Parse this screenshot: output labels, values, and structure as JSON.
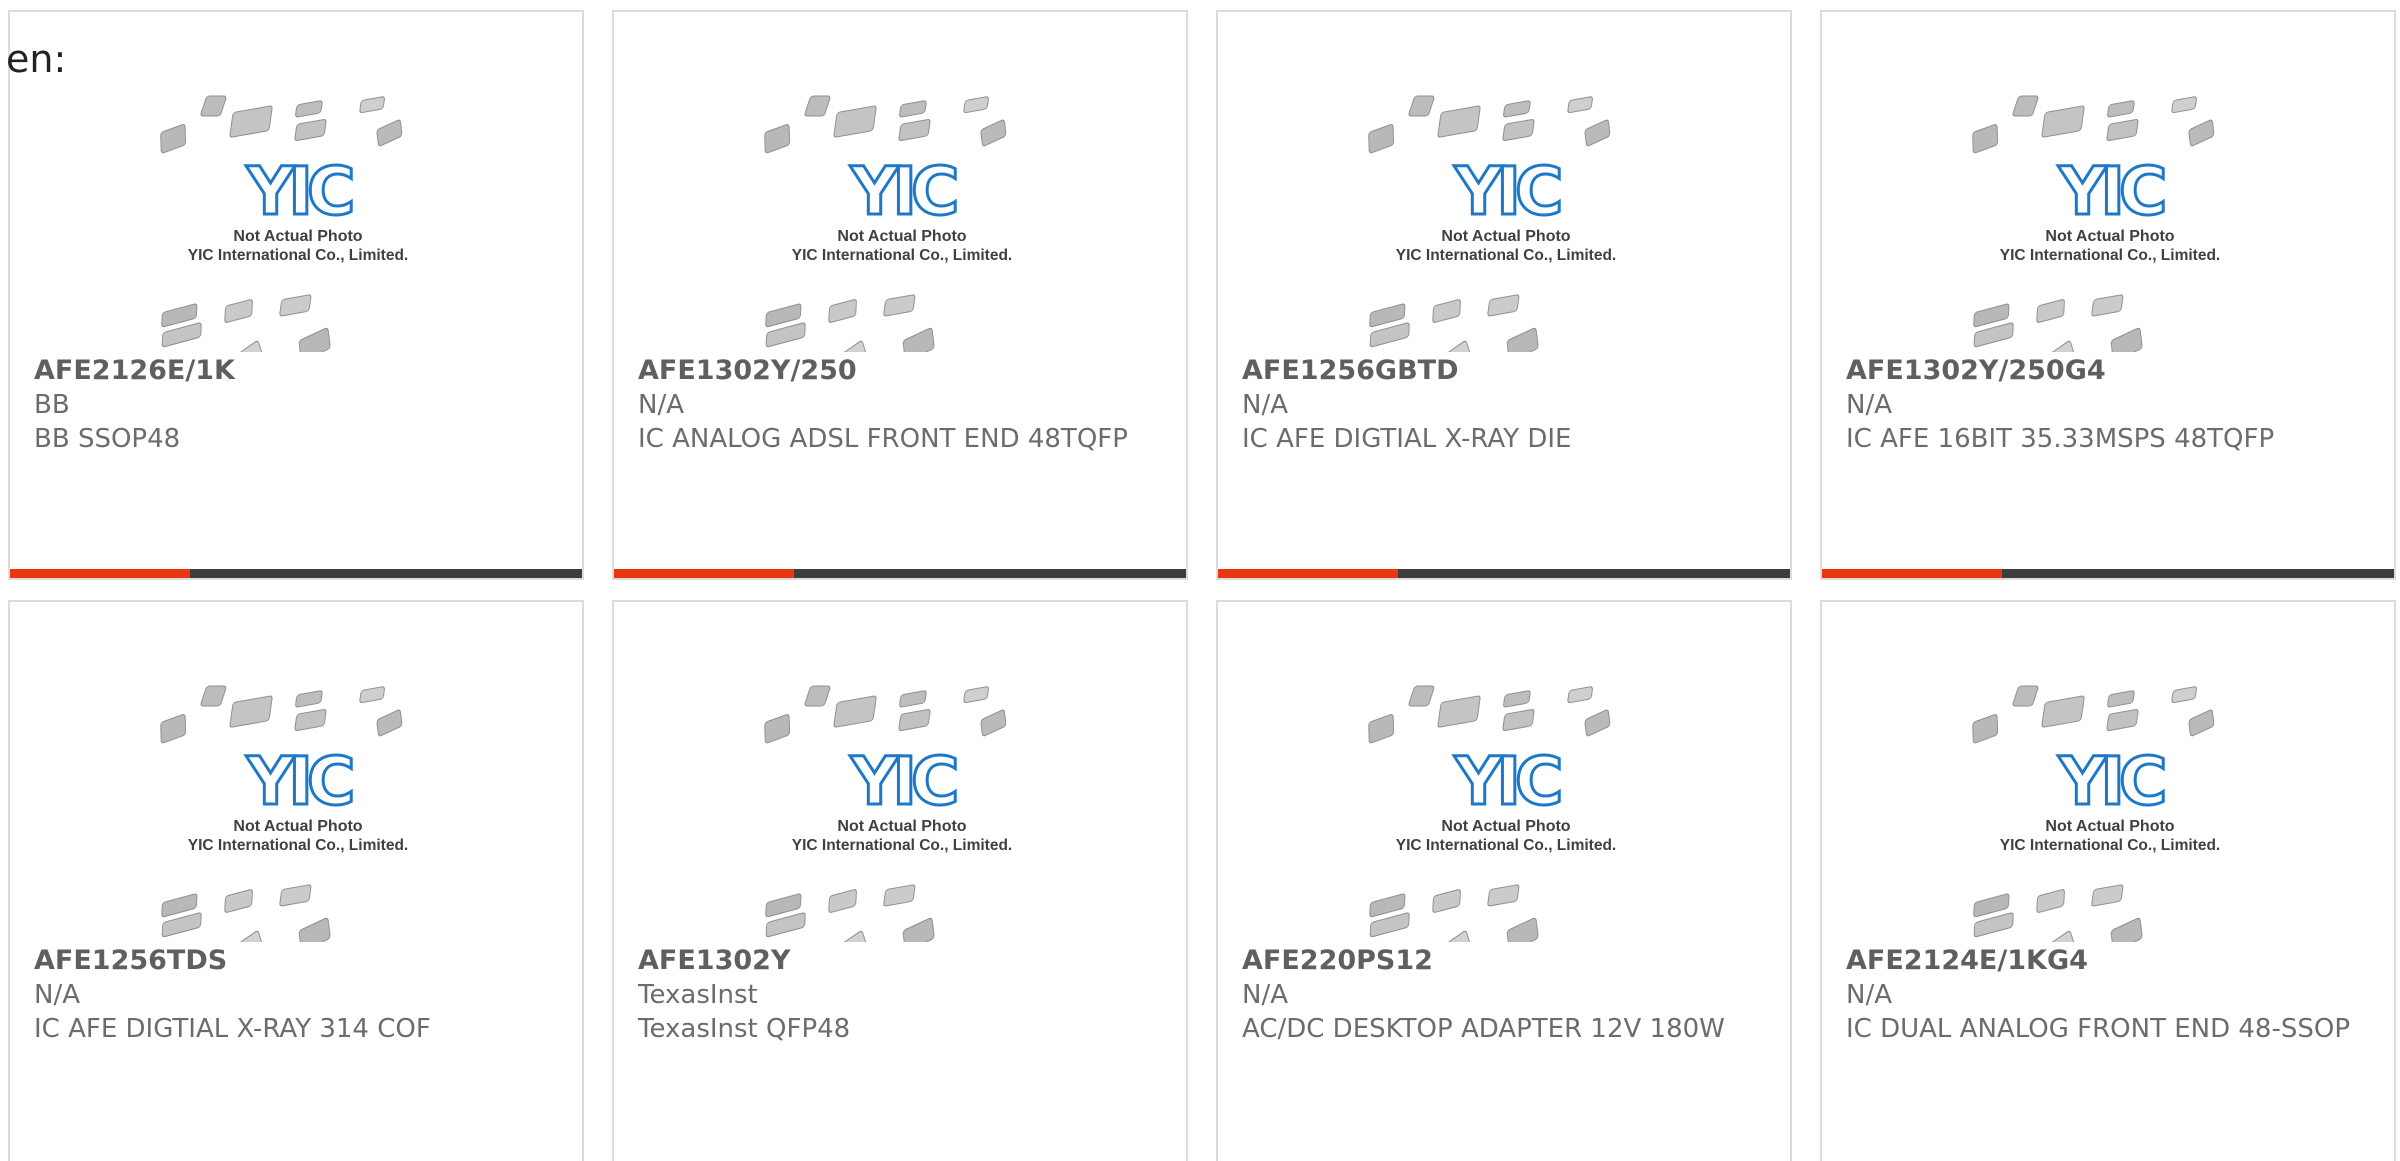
{
  "lang_fragment": "en:",
  "placeholder": {
    "line1": "Not Actual Photo",
    "line2": "YIC International Co., Limited.",
    "logo_text": "YIC"
  },
  "colors": {
    "accent_bar": "#e8360e",
    "dark_bar": "#3d3d3d",
    "logo_blue": "#1e78c8",
    "text_gray": "#6c6c6c"
  },
  "products": [
    {
      "part": "AFE2126E/1K",
      "mfr": "BB",
      "desc": "BB SSOP48"
    },
    {
      "part": "AFE1302Y/250",
      "mfr": "N/A",
      "desc": "IC ANALOG ADSL FRONT END 48TQFP"
    },
    {
      "part": "AFE1256GBTD",
      "mfr": "N/A",
      "desc": "IC AFE DIGTIAL X-RAY DIE"
    },
    {
      "part": "AFE1302Y/250G4",
      "mfr": "N/A",
      "desc": "IC AFE 16BIT 35.33MSPS 48TQFP"
    },
    {
      "part": "AFE1256TDS",
      "mfr": "N/A",
      "desc": "IC AFE DIGTIAL X-RAY 314 COF"
    },
    {
      "part": "AFE1302Y",
      "mfr": "TexasInst",
      "desc": "TexasInst QFP48"
    },
    {
      "part": "AFE220PS12",
      "mfr": "N/A",
      "desc": "AC/DC DESKTOP ADAPTER 12V 180W"
    },
    {
      "part": "AFE2124E/1KG4",
      "mfr": "N/A",
      "desc": "IC DUAL ANALOG FRONT END 48-SSOP"
    }
  ]
}
